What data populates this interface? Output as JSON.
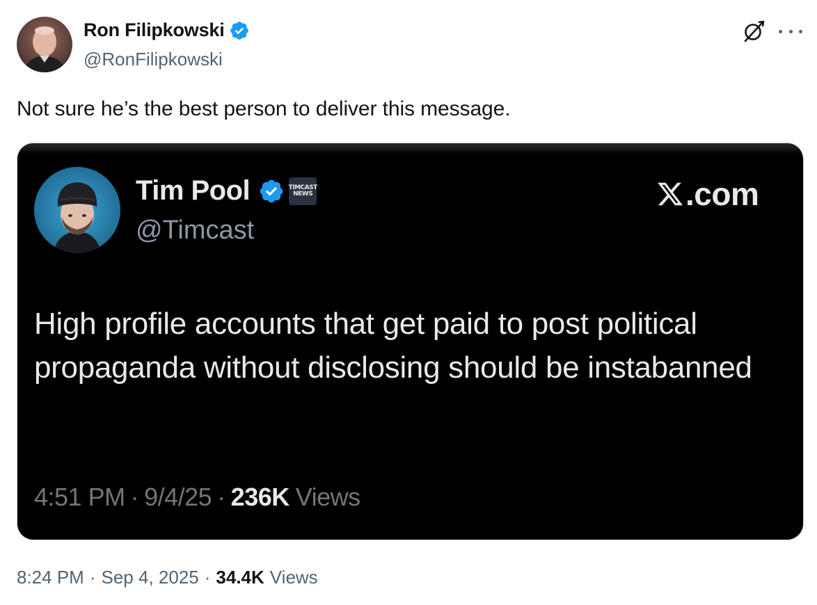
{
  "tweet": {
    "author": {
      "name": "Ron Filipkowski",
      "handle": "@RonFilipkowski",
      "verified_icon": "verified-badge-icon"
    },
    "text": "Not sure he’s the best person to deliver this message.",
    "timestamp": {
      "time": "8:24 PM",
      "date": "Sep 4, 2025",
      "views_count": "34.4K",
      "views_label": "Views"
    },
    "icons": {
      "grok": "grok-icon",
      "more": "more-options-icon"
    }
  },
  "embedded_image": {
    "author": {
      "name": "Tim Pool",
      "handle": "@Timcast",
      "affiliate_badge_line1": "TIMCAST",
      "affiliate_badge_line2": "NEWS"
    },
    "site": ".com",
    "text": "High profile accounts that get paid to post political propaganda without disclosing should be instabanned",
    "meta": {
      "time": "4:51 PM",
      "date": "9/4/25",
      "views_count": "236K",
      "views_label": "Views"
    }
  },
  "colors": {
    "primary_text": "#0f1419",
    "secondary_text": "#536471",
    "verified_blue": "#1d9bf0",
    "card_background": "#000000",
    "card_text": "#e7e9ea",
    "card_secondary_text": "#71767b"
  }
}
